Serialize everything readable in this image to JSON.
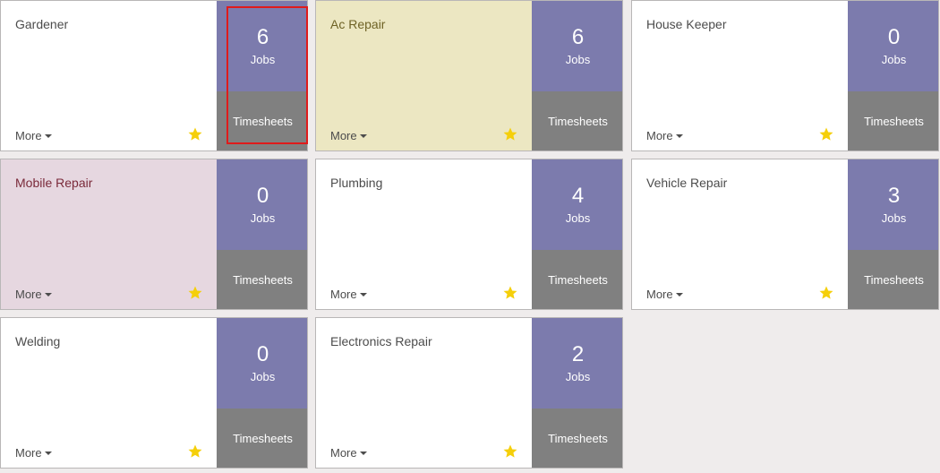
{
  "cards": [
    {
      "title": "Gardener",
      "jobs_count": "6",
      "jobs_label": "Jobs",
      "timesheets_label": "Timesheets",
      "more_label": "More",
      "favorite": true
    },
    {
      "title": "Ac Repair",
      "jobs_count": "6",
      "jobs_label": "Jobs",
      "timesheets_label": "Timesheets",
      "more_label": "More",
      "favorite": true
    },
    {
      "title": "House Keeper",
      "jobs_count": "0",
      "jobs_label": "Jobs",
      "timesheets_label": "Timesheets",
      "more_label": "More",
      "favorite": true
    },
    {
      "title": "Mobile Repair",
      "jobs_count": "0",
      "jobs_label": "Jobs",
      "timesheets_label": "Timesheets",
      "more_label": "More",
      "favorite": true
    },
    {
      "title": "Plumbing",
      "jobs_count": "4",
      "jobs_label": "Jobs",
      "timesheets_label": "Timesheets",
      "more_label": "More",
      "favorite": true
    },
    {
      "title": "Vehicle Repair",
      "jobs_count": "3",
      "jobs_label": "Jobs",
      "timesheets_label": "Timesheets",
      "more_label": "More",
      "favorite": true
    },
    {
      "title": "Welding",
      "jobs_count": "0",
      "jobs_label": "Jobs",
      "timesheets_label": "Timesheets",
      "more_label": "More",
      "favorite": true
    },
    {
      "title": "Electronics Repair",
      "jobs_count": "2",
      "jobs_label": "Jobs",
      "timesheets_label": "Timesheets",
      "more_label": "More",
      "favorite": true
    }
  ],
  "colors": {
    "jobs_background": "#7c7bad",
    "timesheets_background": "#808080",
    "star": "#f5cf0a",
    "highlight_border": "#e01b1b",
    "card_yellow": "#ece7c2",
    "card_pink": "#e6d7e0"
  },
  "icons": {
    "favorite": "star-icon",
    "more": "caret-down-icon"
  }
}
